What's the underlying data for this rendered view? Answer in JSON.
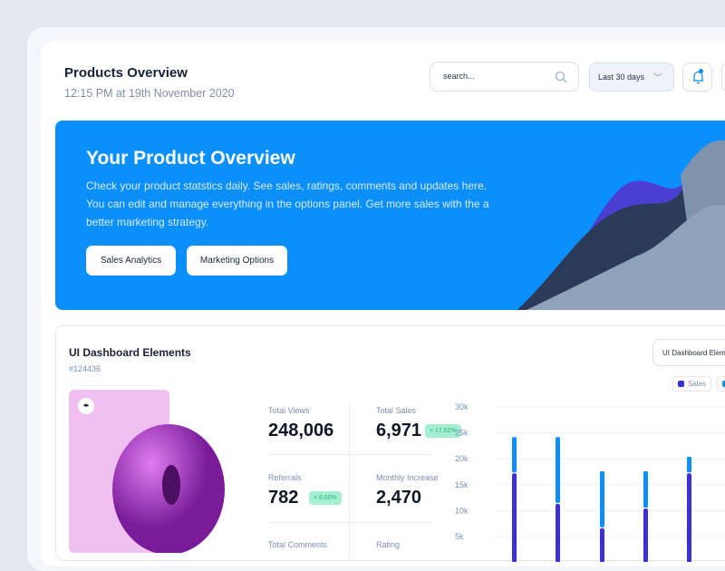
{
  "header": {
    "title": "Products Overview",
    "subtitle": "12:15 PM at 19th November 2020",
    "search_placeholder": "search...",
    "range": "Last 30 days"
  },
  "banner": {
    "title": "Your Product Overview",
    "text": "Check your product statstics daily. See sales, ratings, comments and updates here. You can edit and manage everything in the options panel. Get more sales with the a better marketing strategy.",
    "btn1": "Sales Analytics",
    "btn2": "Marketing Options"
  },
  "card": {
    "title": "UI Dashboard Elements",
    "id": "#124436",
    "dropdown": "UI Dashboard Elements",
    "toggle": "◂▸"
  },
  "stats": [
    {
      "label": "Total Views",
      "value": "248,006"
    },
    {
      "label": "Total Sales",
      "value": "6,971",
      "badge": "+ 17,02%"
    },
    {
      "label": "Referrals",
      "value": "782",
      "badge": "+ 8,60%"
    },
    {
      "label": "Monthly Increase",
      "value": "2,470"
    },
    {
      "label": "Total Comments",
      "value": ""
    },
    {
      "label": "Rating",
      "value": ""
    }
  ],
  "colors": {
    "accent": "#0a8ffb",
    "sales": "#3c2fd6",
    "secondary": "#0a8ffb"
  },
  "chart_data": {
    "type": "bar",
    "stacked": true,
    "ylim": [
      0,
      30000
    ],
    "yticks": [
      "5k",
      "10k",
      "15k",
      "20k",
      "25k",
      "30k"
    ],
    "grid": true,
    "legend": "top-right",
    "series": [
      {
        "name": "Sales",
        "values": [
          17200,
          11300,
          6600,
          10400,
          17200
        ]
      },
      {
        "name": "",
        "values": [
          7000,
          12900,
          11000,
          7200,
          3200
        ]
      }
    ]
  }
}
